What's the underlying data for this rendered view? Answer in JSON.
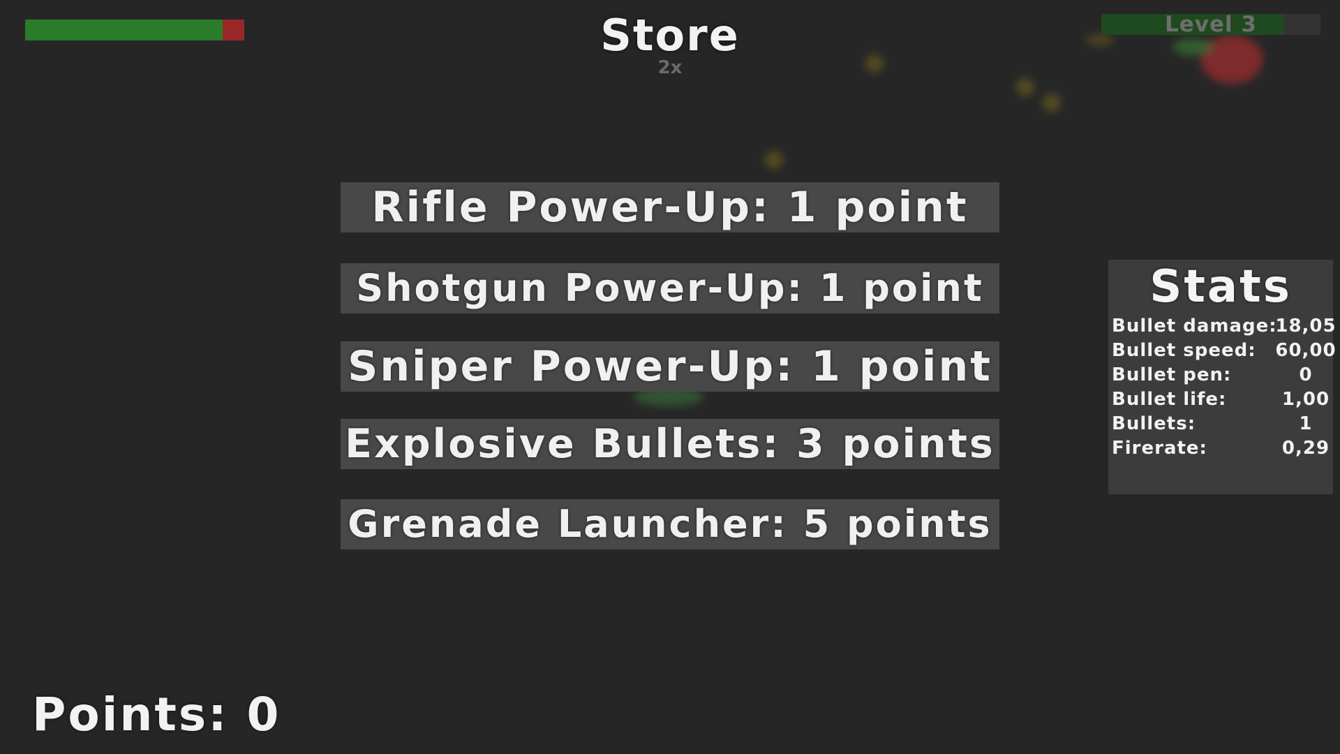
{
  "store": {
    "title": "Store",
    "multiplier": "2x",
    "items": [
      {
        "label": "Rifle Power-Up:  1 point"
      },
      {
        "label": "Shotgun Power-Up:  1 point"
      },
      {
        "label": "Sniper Power-Up:  1 point"
      },
      {
        "label": "Explosive Bullets:  3 points"
      },
      {
        "label": "Grenade Launcher:  5 points"
      }
    ]
  },
  "hud": {
    "health_fraction": 0.9,
    "level_label": "Level 3",
    "level_progress_fraction": 0.83,
    "points_label": "Points: 0"
  },
  "stats": {
    "title": "Stats",
    "rows": [
      {
        "label": "Bullet damage:",
        "value": "18,05"
      },
      {
        "label": "Bullet speed:",
        "value": "60,00"
      },
      {
        "label": "Bullet pen:",
        "value": "0"
      },
      {
        "label": "Bullet life:",
        "value": "1,00"
      },
      {
        "label": "Bullets:",
        "value": "1"
      },
      {
        "label": "Firerate:",
        "value": "0,29"
      }
    ]
  },
  "colors": {
    "background": "#262626",
    "health_fill": "#2a7c2a",
    "health_missing": "#9a2727",
    "button_bg": "#484848",
    "stats_bg": "#3c3c3c",
    "text": "#f2f2f2"
  }
}
